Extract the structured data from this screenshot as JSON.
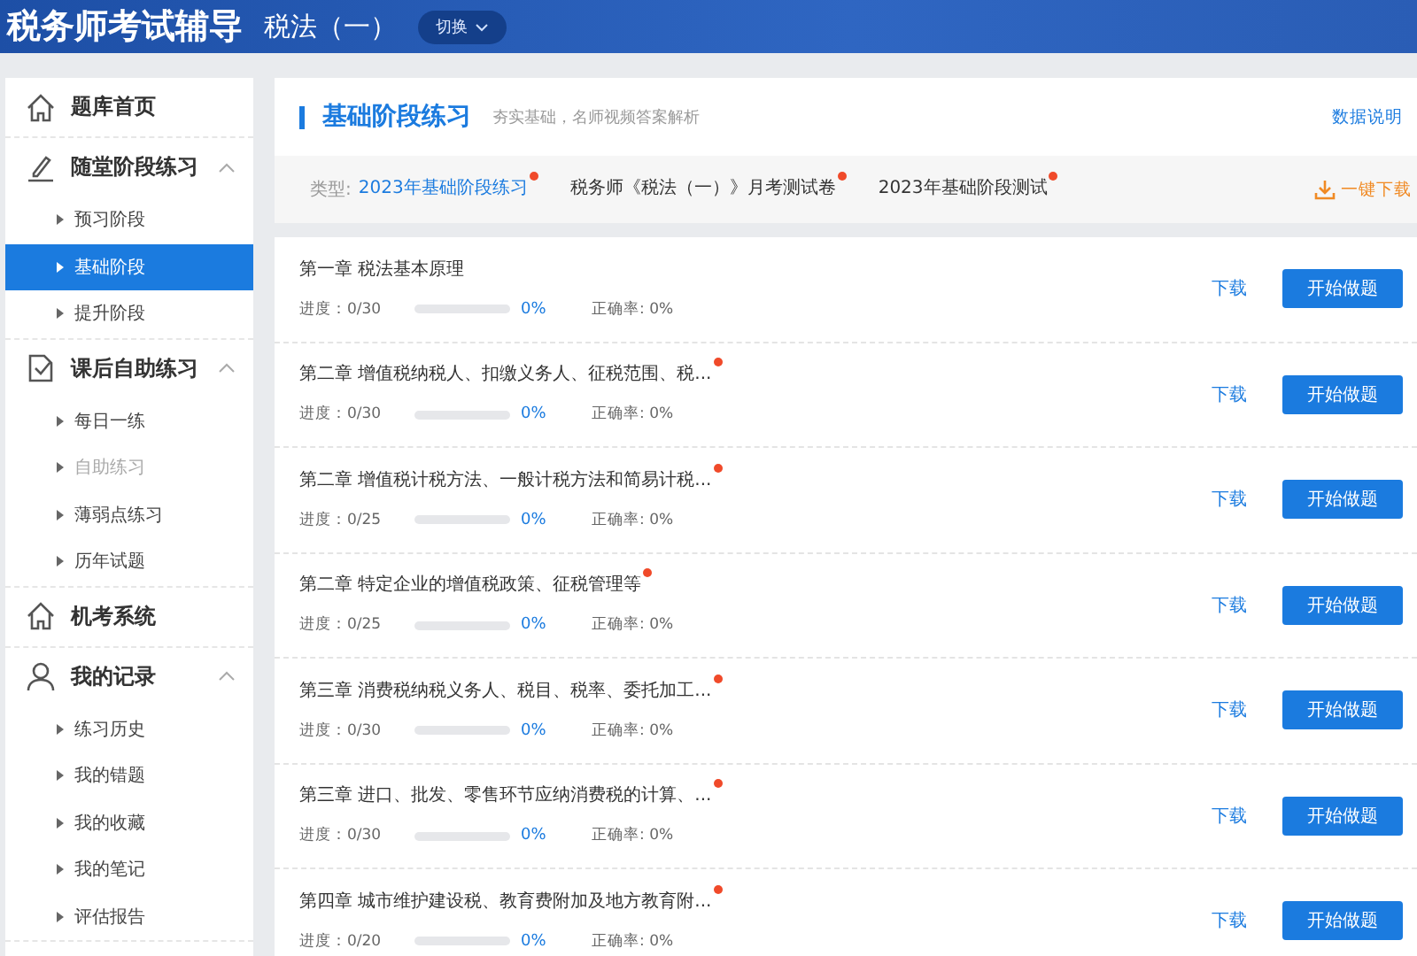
{
  "header": {
    "title": "税务师考试辅导",
    "subject": "税法（一）",
    "switch_button": "切换"
  },
  "sidebar": {
    "groups": [
      {
        "label": "题库首页",
        "expanded": false
      },
      {
        "label": "随堂阶段练习",
        "expanded": true,
        "children": [
          {
            "label": "预习阶段",
            "selected": false,
            "disabled": false
          },
          {
            "label": "基础阶段",
            "selected": true,
            "disabled": false
          },
          {
            "label": "提升阶段",
            "selected": false,
            "disabled": false
          }
        ]
      },
      {
        "label": "课后自助练习",
        "expanded": true,
        "children": [
          {
            "label": "每日一练",
            "selected": false,
            "disabled": false
          },
          {
            "label": "自助练习",
            "selected": false,
            "disabled": true
          },
          {
            "label": "薄弱点练习",
            "selected": false,
            "disabled": false
          },
          {
            "label": "历年试题",
            "selected": false,
            "disabled": false
          }
        ]
      },
      {
        "label": "机考系统",
        "expanded": false
      },
      {
        "label": "我的记录",
        "expanded": true,
        "children": [
          {
            "label": "练习历史",
            "selected": false,
            "disabled": false
          },
          {
            "label": "我的错题",
            "selected": false,
            "disabled": false
          },
          {
            "label": "我的收藏",
            "selected": false,
            "disabled": false
          },
          {
            "label": "我的笔记",
            "selected": false,
            "disabled": false
          },
          {
            "label": "评估报告",
            "selected": false,
            "disabled": false
          }
        ]
      }
    ]
  },
  "section": {
    "title": "基础阶段练习",
    "subtitle": "夯实基础，名师视频答案解析",
    "help_link": "数据说明"
  },
  "type_bar": {
    "label": "类型:",
    "download_all": "一键下载",
    "tabs": [
      {
        "label": "2023年基础阶段练习",
        "selected": true,
        "new": true
      },
      {
        "label": "税务师《税法（一）》月考测试卷",
        "selected": false,
        "new": true
      },
      {
        "label": "2023年基础阶段测试",
        "selected": false,
        "new": true
      }
    ]
  },
  "chapters": [
    {
      "title": "第一章 税法基本原理",
      "new": false,
      "progress": "进度：0/30",
      "level": 0,
      "percent": "0%",
      "accuracy": "正确率: 0%",
      "download": "下载",
      "start": "开始做题"
    },
    {
      "title": "第二章 增值税纳税人、扣缴义务人、征税范围、税...",
      "new": true,
      "progress": "进度：0/30",
      "level": 0,
      "percent": "0%",
      "accuracy": "正确率: 0%",
      "download": "下载",
      "start": "开始做题"
    },
    {
      "title": "第二章 增值税计税方法、一般计税方法和简易计税...",
      "new": true,
      "progress": "进度：0/25",
      "level": 0,
      "percent": "0%",
      "accuracy": "正确率: 0%",
      "download": "下载",
      "start": "开始做题"
    },
    {
      "title": "第二章 特定企业的增值税政策、征税管理等",
      "new": true,
      "progress": "进度：0/25",
      "level": 0,
      "percent": "0%",
      "accuracy": "正确率: 0%",
      "download": "下载",
      "start": "开始做题"
    },
    {
      "title": "第三章 消费税纳税义务人、税目、税率、委托加工...",
      "new": true,
      "progress": "进度：0/30",
      "level": 0,
      "percent": "0%",
      "accuracy": "正确率: 0%",
      "download": "下载",
      "start": "开始做题"
    },
    {
      "title": "第三章 进口、批发、零售环节应纳消费税的计算、...",
      "new": true,
      "progress": "进度：0/30",
      "level": 0,
      "percent": "0%",
      "accuracy": "正确率: 0%",
      "download": "下载",
      "start": "开始做题"
    },
    {
      "title": "第四章 城市维护建设税、教育费附加及地方教育附...",
      "new": true,
      "progress": "进度：0/20",
      "level": 0,
      "percent": "0%",
      "accuracy": "正确率: 0%",
      "download": "下载",
      "start": "开始做题"
    }
  ]
}
